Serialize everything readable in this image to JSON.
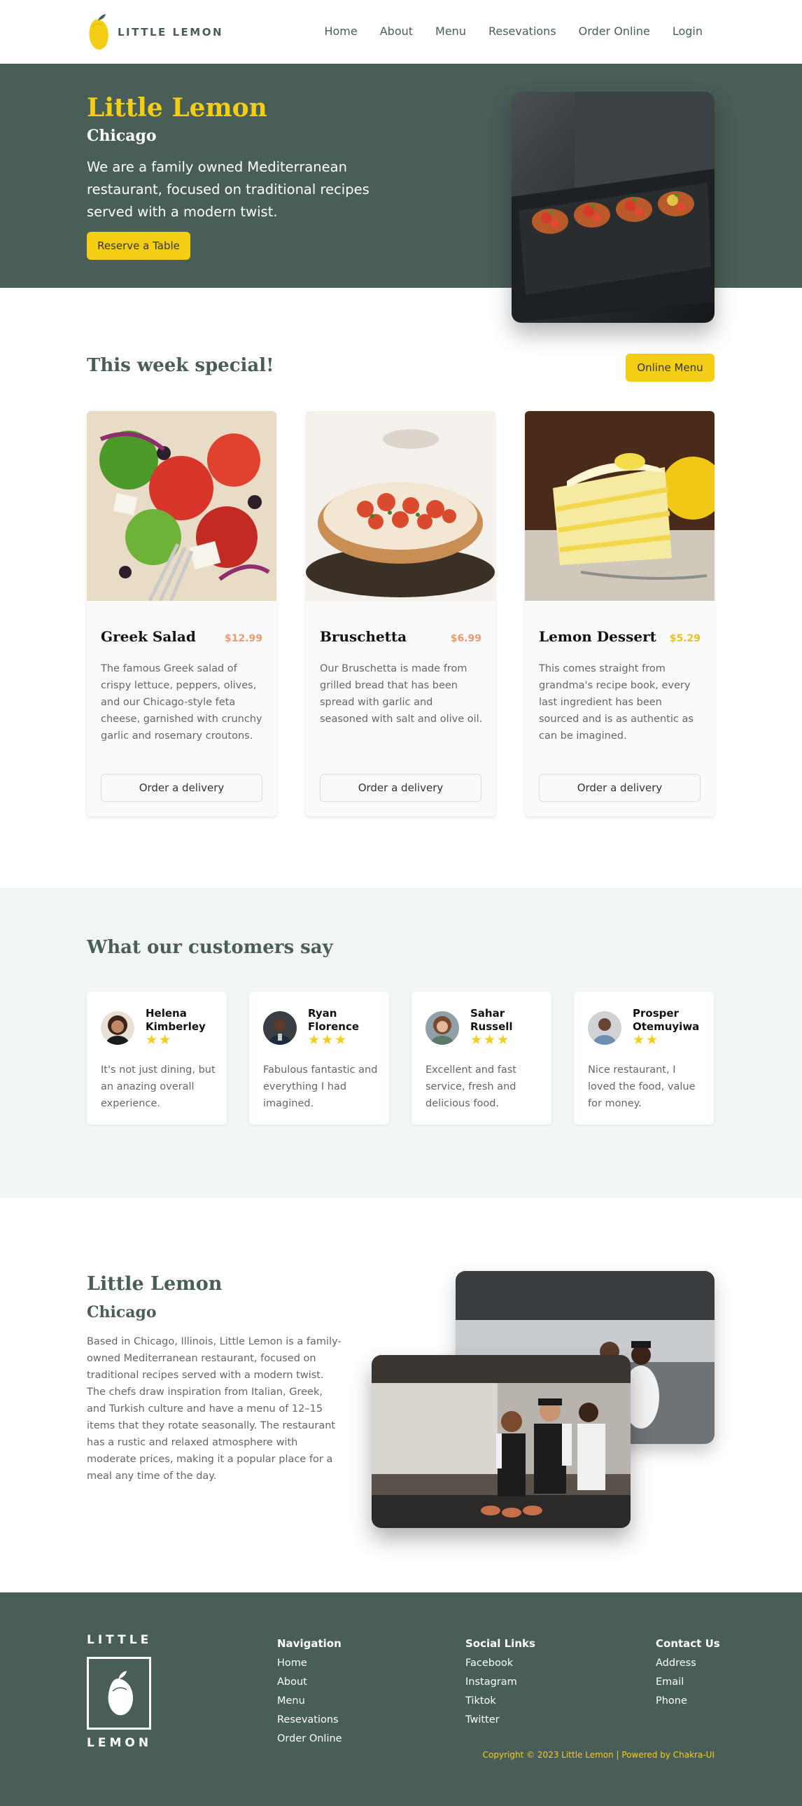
{
  "nav": {
    "brand": "LITTLE LEMON",
    "links": [
      "Home",
      "About",
      "Menu",
      "Resevations",
      "Order Online",
      "Login"
    ]
  },
  "hero": {
    "title": "Little Lemon",
    "subtitle": "Chicago",
    "description": "We are a family owned Mediterranean restaurant, focused on traditional recipes served with a modern twist.",
    "button": "Reserve a Table"
  },
  "specials": {
    "title": "This week special!",
    "button": "Online Menu",
    "cards": [
      {
        "name": "Greek Salad",
        "price": "$12.99",
        "description": "The famous Greek salad of crispy lettuce, peppers, olives, and our Chicago-style feta cheese, garnished with crunchy garlic and rosemary croutons.",
        "button": "Order a delivery"
      },
      {
        "name": "Bruschetta",
        "price": "$6.99",
        "description": "Our Bruschetta is made from grilled bread that has been spread with garlic and seasoned with salt and olive oil.",
        "button": "Order a delivery"
      },
      {
        "name": "Lemon Dessert",
        "price": "$5.29",
        "description": "This comes straight from grandma's recipe book, every last ingredient has been sourced and is as authentic as can be imagined.",
        "button": "Order a delivery"
      }
    ]
  },
  "testimonials": {
    "title": "What our customers say",
    "items": [
      {
        "name": "Helena Kimberley",
        "rating": 2,
        "stars": "★★",
        "quote": "It's not just dining, but an anazing overall experience."
      },
      {
        "name": "Ryan Florence",
        "rating": 3,
        "stars": "★★★",
        "quote": "Fabulous fantastic and everything I had imagined."
      },
      {
        "name": "Sahar Russell",
        "rating": 3,
        "stars": "★★★",
        "quote": "Excellent and fast service, fresh and delicious food."
      },
      {
        "name": "Prosper Otemuyiwa",
        "rating": 2,
        "stars": "★★",
        "quote": "Nice restaurant, I loved the food, value for money."
      }
    ]
  },
  "about": {
    "title": "Little Lemon",
    "subtitle": "Chicago",
    "description": "Based in Chicago, Illinois, Little Lemon is a family-owned Mediterranean restaurant, focused on traditional recipes served with a modern twist. The chefs draw inspiration from Italian, Greek, and Turkish culture and have a menu of 12–15 items that they rotate seasonally. The restaurant has a rustic and relaxed atmosphere with moderate prices, making it a popular place for a meal any time of the day."
  },
  "footer": {
    "logo_top": "LITTLE",
    "logo_bottom": "LEMON",
    "navigation": {
      "title": "Navigation",
      "links": [
        "Home",
        "About",
        "Menu",
        "Resevations",
        "Order Online"
      ]
    },
    "social": {
      "title": "Social Links",
      "links": [
        "Facebook",
        "Instagram",
        "Tiktok",
        "Twitter"
      ]
    },
    "contact": {
      "title": "Contact Us",
      "links": [
        "Address",
        "Email",
        "Phone"
      ]
    },
    "copyright": "Copyright © 2023 Little Lemon | Powered by Chakra-UI"
  },
  "colors": {
    "primary_green": "#495E57",
    "primary_yellow": "#F4CE14",
    "price_orange": "#EE9972",
    "light_bg": "#F3F6F6"
  },
  "icons": [
    "lemon-logo-icon",
    "star-icon"
  ]
}
